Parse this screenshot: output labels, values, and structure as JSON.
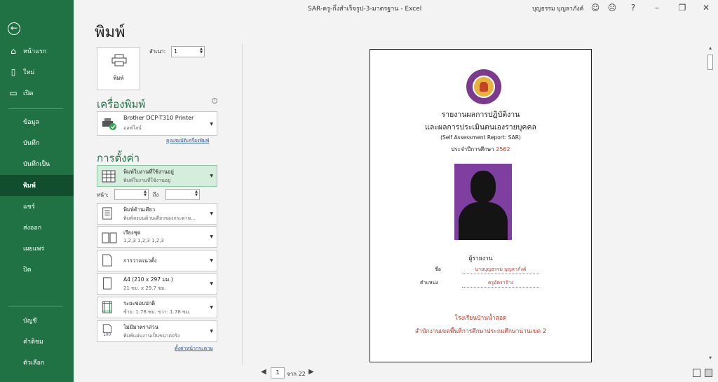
{
  "titlebar": {
    "document": "SAR-ครู-กึ่งสำเร็จรูป-3-มาตรฐาน  -  Excel",
    "user": "บุญธรรม บุญลาภังค์"
  },
  "nav": {
    "back_icon": "back-arrow-icon",
    "items": [
      {
        "label": "หน้าแรก",
        "icon": "home-icon"
      },
      {
        "label": "ใหม่",
        "icon": "new-file-icon"
      },
      {
        "label": "เปิด",
        "icon": "open-folder-icon"
      },
      {
        "label": "ข้อมูล"
      },
      {
        "label": "บันทึก"
      },
      {
        "label": "บันทึกเป็น"
      },
      {
        "label": "พิมพ์"
      },
      {
        "label": "แชร์"
      },
      {
        "label": "ส่งออก"
      },
      {
        "label": "เผยแพร่"
      },
      {
        "label": "ปิด"
      },
      {
        "label": "บัญชี"
      },
      {
        "label": "คำติชม"
      },
      {
        "label": "ตัวเลือก"
      }
    ],
    "active": "พิมพ์"
  },
  "print": {
    "heading": "พิมพ์",
    "print_button": "พิมพ์",
    "copies_label": "สำเนา:",
    "copies_value": "1"
  },
  "printer": {
    "section": "เครื่องพิมพ์",
    "name": "Brother DCP-T310 Printer",
    "status": "ออฟไลน์",
    "properties_link": "คุณสมบัติเครื่องพิมพ์"
  },
  "settings": {
    "section": "การตั้งค่า",
    "what": {
      "t1": "พิมพ์ใบงานที่ใช้งานอยู่",
      "t2": "พิมพ์ใบงานที่ใช้งานอยู่"
    },
    "pages_label": "หน้า:",
    "to_label": "ถึง",
    "pages_from": "",
    "pages_to": "",
    "sides": {
      "t1": "พิมพ์ด้านเดียว",
      "t2": "พิมพ์ลงบนด้านเดียวของกระดาษ..."
    },
    "collate": {
      "t1": "เรียงชุด",
      "t2": "1,2,3    1,2,3    1,2,3"
    },
    "orientation": {
      "t1": "การวางแนวตั้ง"
    },
    "paper": {
      "t1": "A4 (210 x 297 มม.)",
      "t2": "21 ซม. x 29.7 ซม."
    },
    "margins": {
      "t1": "ระยะขอบปกติ",
      "t2": "ซ้าย: 1.78 ซม.   ขวา: 1.78 ซม."
    },
    "scaling": {
      "t1": "ไม่มีมาตราส่วน",
      "t2": "พิมพ์แผ่นงานเป็นขนาดจริง"
    },
    "page_setup_link": "ตั้งค่าหน้ากระดาษ"
  },
  "preview": {
    "title1": "รายงานผลการปฏิบัติงาน",
    "title2": "และผลการประเมินตนเองรายบุคคล",
    "title3": "(Self  Assessment  Report: SAR)",
    "year_prefix": "ประจำปีการศึกษา ",
    "year": "2562",
    "reporter": "ผู้รายงาน",
    "name_label": "ชื่อ",
    "name_value": "นายบุญธรรม  บุญลาภังค์",
    "position_label": "ตำแหน่ง",
    "position_value": "ครูอัตราจ้าง",
    "school": "โรงเรียนบ้านน้ำสอด",
    "office": "สำนักงานเขตพื้นที่การศึกษาประถมศึกษาน่านเขต 2",
    "accent_color": "#c0392b"
  },
  "pager": {
    "current": "1",
    "of_label": "จาก 22"
  }
}
